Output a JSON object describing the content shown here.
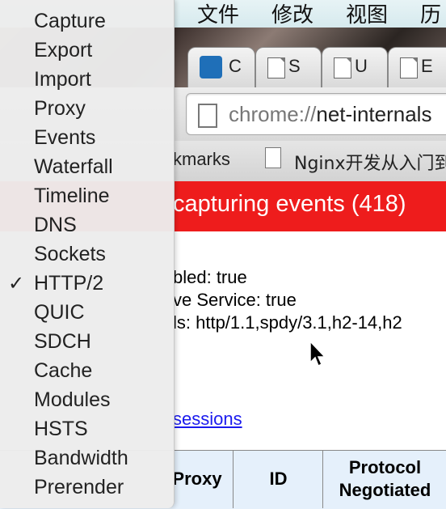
{
  "menubar": {
    "items": [
      "文件",
      "修改",
      "视图",
      "历"
    ]
  },
  "tabs": [
    {
      "label": "C",
      "icon": "chrome-logo-icon"
    },
    {
      "label": "S",
      "icon": "page-icon"
    },
    {
      "label": "U",
      "icon": "page-icon"
    },
    {
      "label": "E",
      "icon": "page-icon"
    }
  ],
  "omnibox": {
    "scheme": "chrome://",
    "rest": "net-internals"
  },
  "bookmarks": {
    "partial": "kmarks",
    "item": "Nginx开发从入门到"
  },
  "banner": {
    "text": "capturing events (418)"
  },
  "content": {
    "line1": "bled: true",
    "line2": "ve Service: true",
    "line3": "ls: http/1.1,spdy/3.1,h2-14,h2",
    "link": "sessions"
  },
  "table_headers": [
    "Proxy",
    "ID",
    "Protocol Negotiated"
  ],
  "menu": {
    "items": [
      "Capture",
      "Export",
      "Import",
      "Proxy",
      "Events",
      "Waterfall",
      "Timeline",
      "DNS",
      "Sockets",
      "HTTP/2",
      "QUIC",
      "SDCH",
      "Cache",
      "Modules",
      "HSTS",
      "Bandwidth",
      "Prerender"
    ],
    "checked": "HTTP/2",
    "check_glyph": "✓"
  }
}
